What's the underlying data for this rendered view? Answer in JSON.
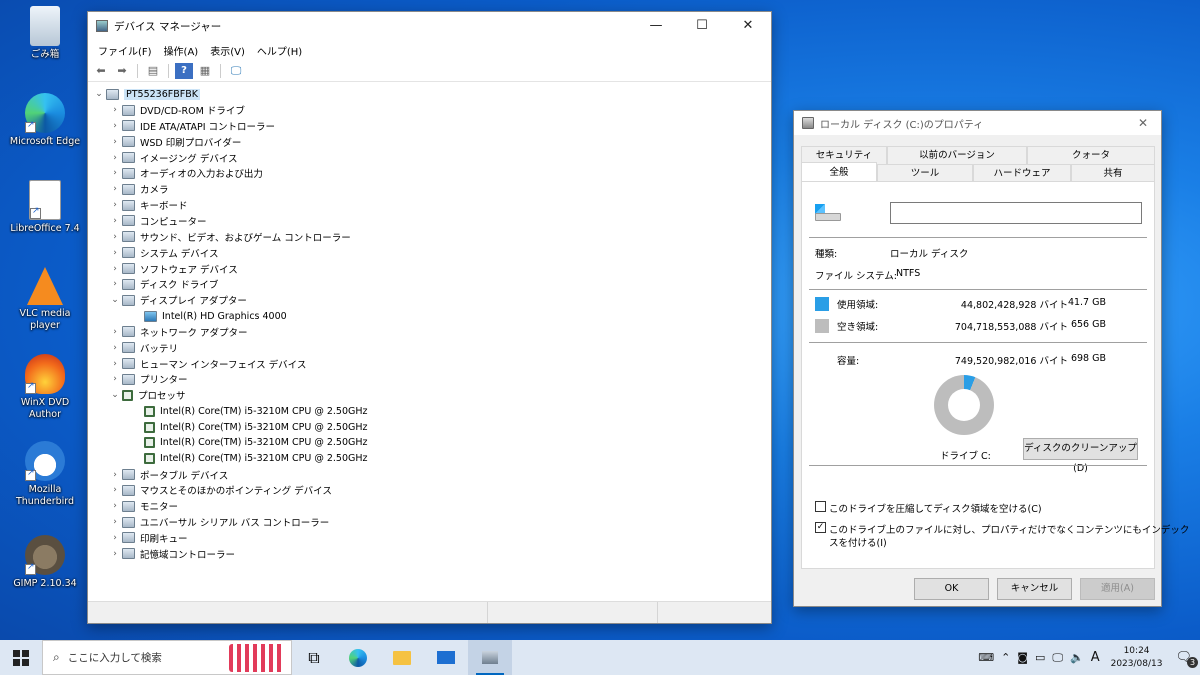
{
  "desktop": {
    "icons": [
      {
        "label": "ごみ箱"
      },
      {
        "label": "Microsoft Edge"
      },
      {
        "label": "LibreOffice 7.4"
      },
      {
        "label": "VLC media player"
      },
      {
        "label": "WinX DVD Author"
      },
      {
        "label": "Mozilla Thunderbird"
      },
      {
        "label": "GIMP 2.10.34"
      }
    ]
  },
  "devmgr": {
    "title": "デバイス マネージャー",
    "menu": [
      "ファイル(F)",
      "操作(A)",
      "表示(V)",
      "ヘルプ(H)"
    ],
    "root": "PT55236FBFBK",
    "tree": [
      {
        "label": "DVD/CD-ROM ドライブ",
        "depth": 1,
        "expanded": false
      },
      {
        "label": "IDE ATA/ATAPI コントローラー",
        "depth": 1,
        "expanded": false
      },
      {
        "label": "WSD 印刷プロバイダー",
        "depth": 1,
        "expanded": false
      },
      {
        "label": "イメージング デバイス",
        "depth": 1,
        "expanded": false
      },
      {
        "label": "オーディオの入力および出力",
        "depth": 1,
        "expanded": false
      },
      {
        "label": "カメラ",
        "depth": 1,
        "expanded": false
      },
      {
        "label": "キーボード",
        "depth": 1,
        "expanded": false
      },
      {
        "label": "コンピューター",
        "depth": 1,
        "expanded": false
      },
      {
        "label": "サウンド、ビデオ、およびゲーム コントローラー",
        "depth": 1,
        "expanded": false
      },
      {
        "label": "システム デバイス",
        "depth": 1,
        "expanded": false
      },
      {
        "label": "ソフトウェア デバイス",
        "depth": 1,
        "expanded": false
      },
      {
        "label": "ディスク ドライブ",
        "depth": 1,
        "expanded": false
      },
      {
        "label": "ディスプレイ アダプター",
        "depth": 1,
        "expanded": true
      },
      {
        "label": "Intel(R) HD Graphics 4000",
        "depth": 2,
        "kind": "disp"
      },
      {
        "label": "ネットワーク アダプター",
        "depth": 1,
        "expanded": false
      },
      {
        "label": "バッテリ",
        "depth": 1,
        "expanded": false
      },
      {
        "label": "ヒューマン インターフェイス デバイス",
        "depth": 1,
        "expanded": false
      },
      {
        "label": "プリンター",
        "depth": 1,
        "expanded": false
      },
      {
        "label": "プロセッサ",
        "depth": 1,
        "expanded": true,
        "kind": "cpu"
      },
      {
        "label": "Intel(R) Core(TM) i5-3210M CPU @ 2.50GHz",
        "depth": 2,
        "kind": "cpu"
      },
      {
        "label": "Intel(R) Core(TM) i5-3210M CPU @ 2.50GHz",
        "depth": 2,
        "kind": "cpu"
      },
      {
        "label": "Intel(R) Core(TM) i5-3210M CPU @ 2.50GHz",
        "depth": 2,
        "kind": "cpu"
      },
      {
        "label": "Intel(R) Core(TM) i5-3210M CPU @ 2.50GHz",
        "depth": 2,
        "kind": "cpu"
      },
      {
        "label": "ポータブル デバイス",
        "depth": 1,
        "expanded": false
      },
      {
        "label": "マウスとそのほかのポインティング デバイス",
        "depth": 1,
        "expanded": false
      },
      {
        "label": "モニター",
        "depth": 1,
        "expanded": false
      },
      {
        "label": "ユニバーサル シリアル バス コントローラー",
        "depth": 1,
        "expanded": false
      },
      {
        "label": "印刷キュー",
        "depth": 1,
        "expanded": false
      },
      {
        "label": "記憶域コントローラー",
        "depth": 1,
        "expanded": false
      }
    ]
  },
  "props": {
    "title": "ローカル ディスク (C:)のプロパティ",
    "tabs_top": [
      "セキュリティ",
      "以前のバージョン",
      "クォータ"
    ],
    "tabs_bottom": [
      "全般",
      "ツール",
      "ハードウェア",
      "共有"
    ],
    "name_value": "",
    "type_label": "種類:",
    "type_value": "ローカル ディスク",
    "fs_label": "ファイル システム:",
    "fs_value": "NTFS",
    "used_label": "使用領域:",
    "used_bytes": "44,802,428,928 バイト",
    "used_gb": "41.7 GB",
    "free_label": "空き領域:",
    "free_bytes": "704,718,553,088 バイト",
    "free_gb": "656 GB",
    "cap_label": "容量:",
    "cap_bytes": "749,520,982,016 バイト",
    "cap_gb": "698 GB",
    "used_fraction": 0.06,
    "drive_label": "ドライブ C:",
    "cleanup_button": "ディスクのクリーンアップ(D)",
    "compress_label": "このドライブを圧縮してディスク領域を空ける(C)",
    "compress_checked": false,
    "index_label_1": "このドライブ上のファイルに対し、プロパティだけでなくコンテンツにもインデック",
    "index_label_2": "スを付ける(I)",
    "index_checked": true,
    "ok_button": "OK",
    "cancel_button": "キャンセル",
    "apply_button": "適用(A)",
    "colors": {
      "used": "#2a9ee6",
      "free": "#bdbdbd"
    }
  },
  "taskbar": {
    "search_placeholder": "ここに入力して検索",
    "ime": "A",
    "time": "10:24",
    "date": "2023/08/13",
    "notification_count": "3"
  }
}
